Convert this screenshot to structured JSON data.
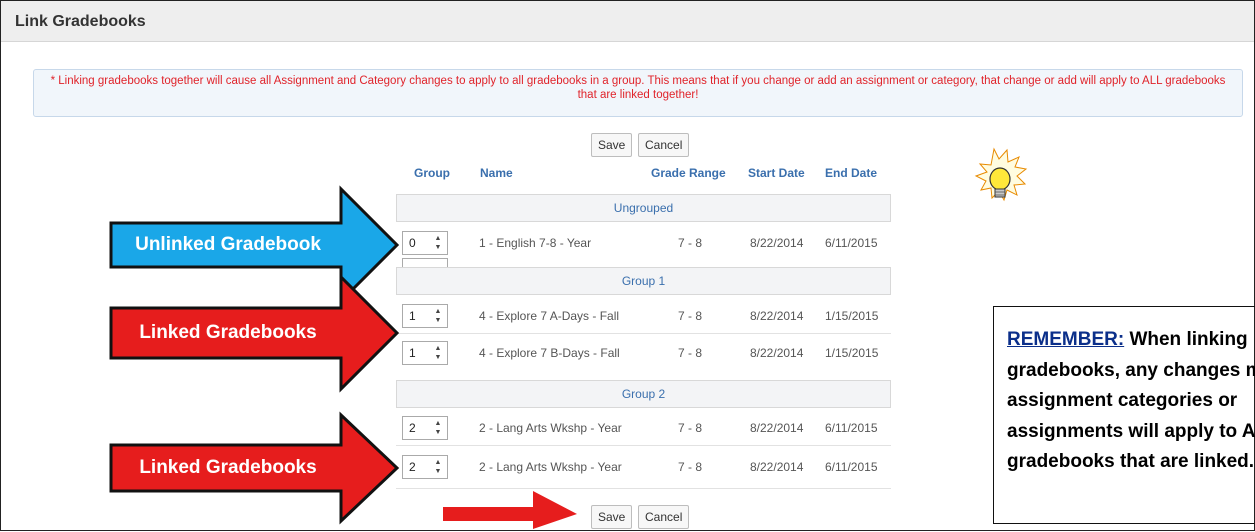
{
  "page": {
    "title": "Link Gradebooks"
  },
  "warning": "* Linking gradebooks together will cause all Assignment and Category changes to apply to all gradebooks in a group. This means that if you change or add an assignment or category, that change or add will apply to ALL gradebooks that are linked together!",
  "buttons": {
    "save": "Save",
    "cancel": "Cancel"
  },
  "columns": {
    "group": "Group",
    "name": "Name",
    "grade_range": "Grade Range",
    "start_date": "Start Date",
    "end_date": "End Date"
  },
  "groups": [
    {
      "label": "Ungrouped",
      "rows": [
        {
          "group": "0",
          "name": "1 - English 7-8 - Year",
          "grade": "7 - 8",
          "start": "8/22/2014",
          "end": "6/11/2015"
        }
      ]
    },
    {
      "label": "Group 1",
      "rows": [
        {
          "group": "1",
          "name": "4 - Explore 7 A-Days - Fall",
          "grade": "7 - 8",
          "start": "8/22/2014",
          "end": "1/15/2015"
        },
        {
          "group": "1",
          "name": "4 - Explore 7 B-Days - Fall",
          "grade": "7 - 8",
          "start": "8/22/2014",
          "end": "1/15/2015"
        }
      ]
    },
    {
      "label": "Group 2",
      "rows": [
        {
          "group": "2",
          "name": "2 - Lang Arts Wkshp - Year",
          "grade": "7 - 8",
          "start": "8/22/2014",
          "end": "6/11/2015"
        },
        {
          "group": "2",
          "name": "2 - Lang Arts Wkshp - Year",
          "grade": "7 - 8",
          "start": "8/22/2014",
          "end": "6/11/2015"
        }
      ]
    }
  ],
  "callouts": {
    "unlinked": "Unlinked Gradebook",
    "linked1": "Linked Gradebooks",
    "linked2": "Linked Gradebooks"
  },
  "note": {
    "lead": "REMEMBER:",
    "body": " When linking gradebooks, any changes made to assignment categories or assignments will apply to ALL gradebooks that are linked."
  },
  "colors": {
    "blue_arrow": "#1aa7e8",
    "red_arrow": "#e61d1d",
    "header_text": "#3a6fad",
    "warning_text": "#e0232a"
  },
  "icons": {
    "stepper": "spinner-up-down-icon",
    "lightbulb": "lightbulb-icon",
    "pointer": "red-pointer-arrow-icon"
  }
}
